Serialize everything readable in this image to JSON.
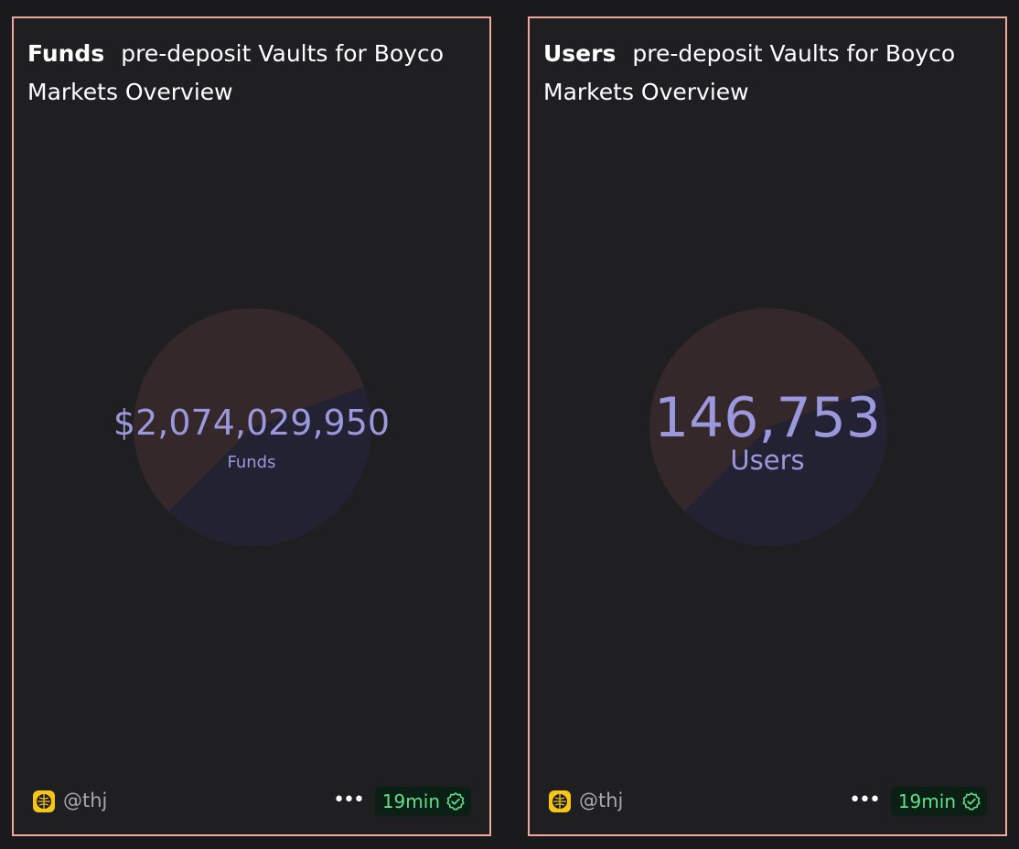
{
  "colors": {
    "slice_a": "#34282a",
    "slice_b": "#222233",
    "value_text": "#9b98dd",
    "border": "#f0a89c",
    "badge_text": "#5fe08a"
  },
  "cards": [
    {
      "title_strong": "Funds",
      "title_rest": "pre-deposit Vaults for Boyco Markets Overview",
      "value": "$2,074,029,950",
      "label": "Funds",
      "author": "@thj",
      "more_label": "•••",
      "age": "19min",
      "icon": "verified-check-icon"
    },
    {
      "title_strong": "Users",
      "title_rest": "pre-deposit Vaults for Boyco Markets Overview",
      "value": "146,753",
      "label": "Users",
      "author": "@thj",
      "more_label": "•••",
      "age": "19min",
      "icon": "verified-check-icon"
    }
  ],
  "chart_data": [
    {
      "type": "pie",
      "title": "Funds",
      "values": [
        0.57,
        0.43
      ],
      "colors": [
        "#34282a",
        "#222233"
      ]
    },
    {
      "type": "pie",
      "title": "Users",
      "values": [
        0.57,
        0.43
      ],
      "colors": [
        "#34282a",
        "#222233"
      ]
    }
  ]
}
